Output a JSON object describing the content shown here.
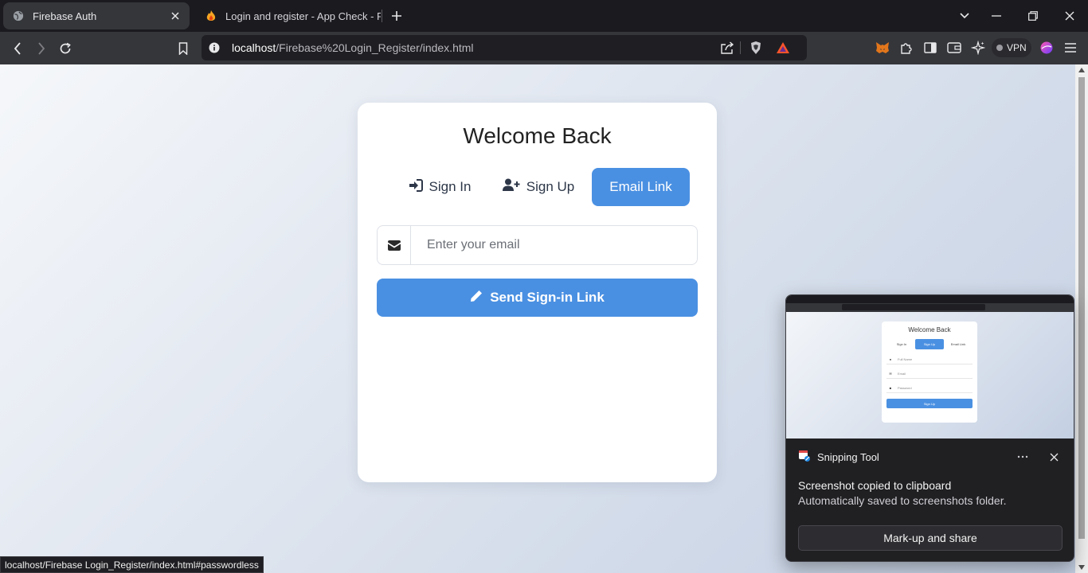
{
  "browser": {
    "tabs": [
      {
        "title": "Firebase Auth",
        "icon": "globe-icon",
        "active": true
      },
      {
        "title": "Login and register - App Check - Fir",
        "icon": "firebase-flame-icon",
        "active": false
      }
    ],
    "url": {
      "host": "localhost",
      "path": "/Firebase%20Login_Register/index.html"
    },
    "vpn_label": "VPN"
  },
  "auth": {
    "heading": "Welcome Back",
    "tabs": [
      {
        "label": "Sign In",
        "icon": "sign-in-icon"
      },
      {
        "label": "Sign Up",
        "icon": "user-plus-icon"
      },
      {
        "label": "Email Link",
        "active": true
      }
    ],
    "email_placeholder": "Enter your email",
    "send_button": "Send Sign-in Link",
    "accent_color": "#4a90e2"
  },
  "status_bar": {
    "text": "localhost/Firebase Login_Register/index.html#passwordless"
  },
  "toast": {
    "app_name": "Snipping Tool",
    "title": "Screenshot copied to clipboard",
    "subtitle": "Automatically saved to screenshots folder.",
    "button": "Mark-up and share",
    "preview": {
      "heading": "Welcome Back",
      "tabs": [
        "Sign In",
        "Sign Up",
        "Email Link"
      ],
      "fields": [
        "Full Name",
        "Email",
        "Password"
      ],
      "button": "Sign Up"
    }
  }
}
